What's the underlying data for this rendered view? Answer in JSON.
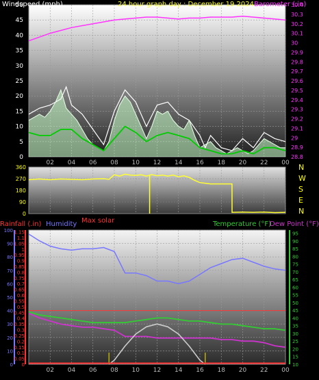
{
  "colors": {
    "background": "#000000",
    "windspeed": "#ffffff",
    "wind_avg": "#00cc00",
    "wind_fill": "#c8ffc8",
    "barometer": "#ff33ff",
    "direction": "#ffff33",
    "rainfall": "#ff3333",
    "humidity": "#7777ff",
    "solar": "#cccccc",
    "temperature": "#33cc33",
    "dewpoint": "#cc33cc",
    "compass": "#ffff00",
    "maxsolar": "#ff3333"
  },
  "chart_data": [
    {
      "type": "line",
      "title": "24 hour graph day : December 19 2024",
      "ylabel": "Windspeed (mph)",
      "y2label": "Barometer (.in)",
      "ylim": [
        0,
        50
      ],
      "y2lim": [
        28.8,
        30.4
      ],
      "yticks": [
        "0",
        "5",
        "10",
        "15",
        "20",
        "25",
        "30",
        "35",
        "40",
        "45",
        "50"
      ],
      "y2ticks": [
        "28.8",
        "28.9",
        "29",
        "29.1",
        "29.2",
        "29.3",
        "29.4",
        "29.5",
        "29.6",
        "29.7",
        "29.8",
        "29.9",
        "30",
        "30.1",
        "30.2",
        "30.3",
        "30.4"
      ],
      "x_ticks": [
        "02",
        "04",
        "06",
        "08",
        "10",
        "12",
        "14",
        "16",
        "18",
        "20",
        "22",
        "00"
      ],
      "series": [
        {
          "name": "Windspeed",
          "axis": "left",
          "x": [
            0,
            0.5,
            1,
            1.5,
            2,
            2.5,
            3,
            3.5,
            4,
            4.5,
            5,
            5.5,
            6,
            6.5,
            7,
            7.5,
            8,
            8.5,
            9,
            9.5,
            10,
            10.5,
            11,
            11.5,
            12,
            12.5,
            13,
            13.5,
            14,
            14.5,
            15,
            15.5,
            16,
            16.5,
            17,
            17.5,
            18,
            18.5,
            19,
            19.5,
            20,
            20.5,
            21,
            21.5,
            22,
            22.5,
            23,
            23.5,
            24
          ],
          "values": [
            12,
            13,
            14,
            13,
            15,
            18,
            22,
            16,
            14,
            12,
            9,
            6,
            4,
            3,
            2,
            5,
            12,
            17,
            20,
            18,
            14,
            10,
            6,
            10,
            15,
            14,
            15,
            12,
            10,
            9,
            12,
            7,
            3,
            4,
            5,
            3,
            2,
            1,
            2,
            3,
            2,
            1,
            2,
            4,
            6,
            5,
            4,
            3,
            3
          ]
        },
        {
          "name": "Gust",
          "axis": "left",
          "x": [
            0,
            1,
            2,
            3,
            3.5,
            4,
            5,
            6,
            7,
            8,
            9,
            10,
            11,
            12,
            13,
            14,
            15,
            16,
            16.5,
            17,
            18,
            19,
            20,
            21,
            22,
            23,
            24
          ],
          "values": [
            14,
            16,
            17,
            19,
            23,
            17,
            14,
            9,
            4,
            15,
            22,
            18,
            10,
            17,
            18,
            14,
            12,
            7,
            3,
            7,
            3,
            2,
            6,
            3,
            8,
            6,
            5
          ]
        },
        {
          "name": "Average",
          "axis": "left",
          "x": [
            0,
            1,
            2,
            3,
            4,
            5,
            6,
            7,
            8,
            9,
            10,
            11,
            12,
            13,
            14,
            15,
            16,
            17,
            18,
            19,
            20,
            21,
            22,
            23,
            24
          ],
          "values": [
            8,
            7,
            7,
            9,
            9,
            6,
            4,
            2,
            6,
            10,
            8,
            5,
            7,
            8,
            7,
            6,
            3,
            2,
            1,
            1,
            2,
            1,
            3,
            3,
            2
          ]
        },
        {
          "name": "Barometer",
          "axis": "right",
          "x": [
            0,
            1,
            2,
            3,
            4,
            5,
            6,
            7,
            8,
            9,
            10,
            11,
            12,
            13,
            14,
            15,
            16,
            17,
            18,
            19,
            20,
            21,
            22,
            23,
            24
          ],
          "values": [
            30.02,
            30.06,
            30.1,
            30.13,
            30.16,
            30.18,
            30.2,
            30.22,
            30.24,
            30.25,
            30.26,
            30.27,
            30.27,
            30.26,
            30.25,
            30.26,
            30.26,
            30.27,
            30.27,
            30.27,
            30.28,
            30.27,
            30.26,
            30.25,
            30.24
          ]
        }
      ]
    },
    {
      "type": "line",
      "title": "",
      "ylim": [
        0,
        360
      ],
      "yticks": [
        "0",
        "90",
        "180",
        "270",
        "360"
      ],
      "compass": [
        "N",
        "W",
        "S",
        "E",
        "N"
      ],
      "x_ticks": [
        "02",
        "04",
        "06",
        "08",
        "10",
        "12",
        "14",
        "16",
        "18",
        "20",
        "22",
        "00"
      ],
      "series": [
        {
          "name": "Wind direction",
          "x": [
            0,
            1,
            2,
            3,
            4,
            5,
            6,
            7,
            7.5,
            8,
            8.5,
            9,
            9.5,
            10,
            10.5,
            11,
            11.5,
            12,
            12.5,
            13,
            13.5,
            14,
            14.5,
            15,
            15.5,
            16,
            16.5,
            17,
            17.5,
            18,
            18.5,
            19,
            19.01,
            20,
            21,
            22,
            23,
            24
          ],
          "values": [
            262,
            268,
            262,
            268,
            265,
            262,
            268,
            270,
            265,
            300,
            290,
            305,
            298,
            295,
            300,
            290,
            302,
            292,
            298,
            290,
            298,
            285,
            292,
            280,
            258,
            240,
            235,
            230,
            230,
            230,
            230,
            230,
            10,
            12,
            10,
            12,
            8,
            10
          ]
        }
      ]
    },
    {
      "type": "line",
      "title": "",
      "left_labels": [
        "Rainfall (.in)",
        "Humidity"
      ],
      "right_labels": [
        "Temperature (°F)",
        "Dew Point (°F)"
      ],
      "annotation": "Max solar",
      "humidity_ticks": [
        "0",
        "10",
        "20",
        "30",
        "40",
        "50",
        "60",
        "70",
        "80",
        "90",
        "100"
      ],
      "rain_ticks": [
        "0",
        "0.05",
        "0.1",
        "0.15",
        "0.2",
        "0.25",
        "0.3",
        "0.35",
        "0.4",
        "0.45",
        "0.5",
        "0.55",
        "0.6",
        "0.65",
        "0.7",
        "0.75",
        "0.8",
        "0.85",
        "0.9",
        "0.95",
        "1",
        "1.05",
        "1.1",
        "1.15"
      ],
      "temp_ticks": [
        "10",
        "15",
        "20",
        "25",
        "30",
        "35",
        "40",
        "45",
        "50",
        "55",
        "60",
        "65",
        "70",
        "75",
        "80",
        "85",
        "90",
        "95"
      ],
      "temp_lim": [
        10,
        97
      ],
      "humidity_lim": [
        0,
        100
      ],
      "x_ticks": [
        "02",
        "04",
        "06",
        "08",
        "10",
        "12",
        "14",
        "16",
        "18",
        "20",
        "22",
        "00"
      ],
      "series": [
        {
          "name": "Humidity",
          "axis": "humidity",
          "x": [
            0,
            1,
            2,
            3,
            4,
            5,
            6,
            7,
            8,
            9,
            10,
            11,
            12,
            13,
            14,
            15,
            16,
            17,
            18,
            19,
            20,
            21,
            22,
            23,
            24
          ],
          "values": [
            97,
            92,
            88,
            86,
            85,
            86,
            86,
            87,
            84,
            68,
            68,
            66,
            62,
            62,
            60,
            62,
            67,
            72,
            75,
            78,
            79,
            76,
            73,
            71,
            70
          ]
        },
        {
          "name": "Temperature",
          "axis": "temp",
          "x": [
            0,
            1,
            2,
            3,
            4,
            5,
            6,
            7,
            8,
            9,
            10,
            11,
            12,
            13,
            14,
            15,
            16,
            17,
            18,
            19,
            20,
            21,
            22,
            23,
            24
          ],
          "values": [
            44,
            42,
            41,
            40,
            39,
            38,
            37,
            37,
            37,
            37,
            38,
            39,
            40,
            40,
            39,
            38,
            38,
            37,
            36,
            36,
            35,
            34,
            33,
            33,
            32
          ]
        },
        {
          "name": "Dew Point",
          "axis": "temp",
          "x": [
            0,
            1,
            2,
            3,
            4,
            5,
            6,
            7,
            8,
            9,
            10,
            11,
            12,
            13,
            14,
            15,
            16,
            17,
            18,
            19,
            20,
            21,
            22,
            23,
            24
          ],
          "values": [
            43,
            40,
            38,
            36,
            35,
            34,
            34,
            33,
            32,
            28,
            28,
            28,
            27,
            27,
            27,
            27,
            27,
            27,
            26,
            26,
            25,
            25,
            24,
            22,
            21
          ]
        },
        {
          "name": "Solar",
          "axis": "solar",
          "x": [
            7.5,
            8,
            9,
            10,
            11,
            12,
            13,
            14,
            15,
            16,
            16.5
          ],
          "values": [
            0,
            0.1,
            0.45,
            0.75,
            0.93,
            1,
            0.93,
            0.75,
            0.45,
            0.1,
            0
          ]
        },
        {
          "name": "Rainfall",
          "axis": "rain",
          "x": [
            0,
            24
          ],
          "values": [
            0,
            0
          ]
        }
      ],
      "threshold_humidity": 40
    }
  ]
}
